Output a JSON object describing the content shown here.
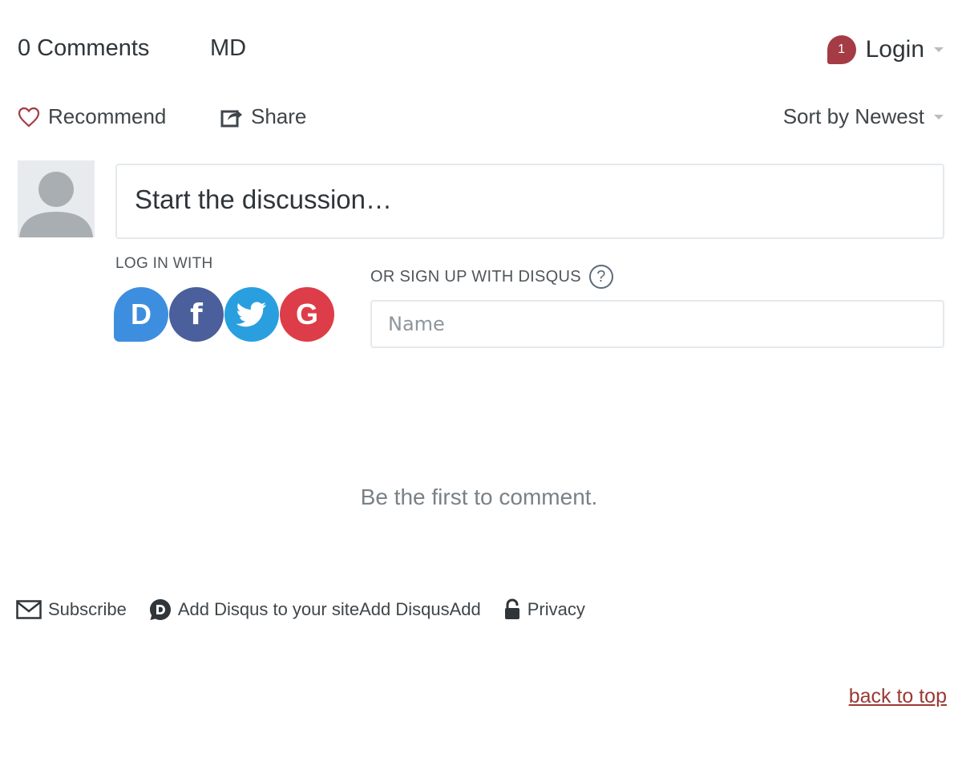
{
  "header": {
    "comment_count": "0 Comments",
    "site": "MD",
    "notification_count": "1",
    "login_label": "Login"
  },
  "actions": {
    "recommend_label": "Recommend",
    "share_label": "Share",
    "sort_label": "Sort by Newest"
  },
  "composer": {
    "placeholder": "Start the discussion…",
    "login_with_label": "LOG IN WITH",
    "signup_label": "OR SIGN UP WITH DISQUS",
    "help_symbol": "?",
    "name_placeholder": "Name",
    "social": [
      {
        "name": "disqus",
        "glyph": "D",
        "color": "#3e8ee0"
      },
      {
        "name": "facebook",
        "glyph": "f",
        "color": "#4a5f9b"
      },
      {
        "name": "twitter",
        "glyph": "",
        "color": "#2a9fe0"
      },
      {
        "name": "google",
        "glyph": "G",
        "color": "#dd3d48"
      }
    ]
  },
  "empty_state": "Be the first to comment.",
  "footer": {
    "subscribe": "Subscribe",
    "add_disqus": "Add Disqus to your siteAdd DisqusAdd",
    "privacy": "Privacy"
  },
  "back_to_top": "back to top",
  "colors": {
    "accent_red": "#a53b44",
    "link_red": "#9a3a32"
  }
}
